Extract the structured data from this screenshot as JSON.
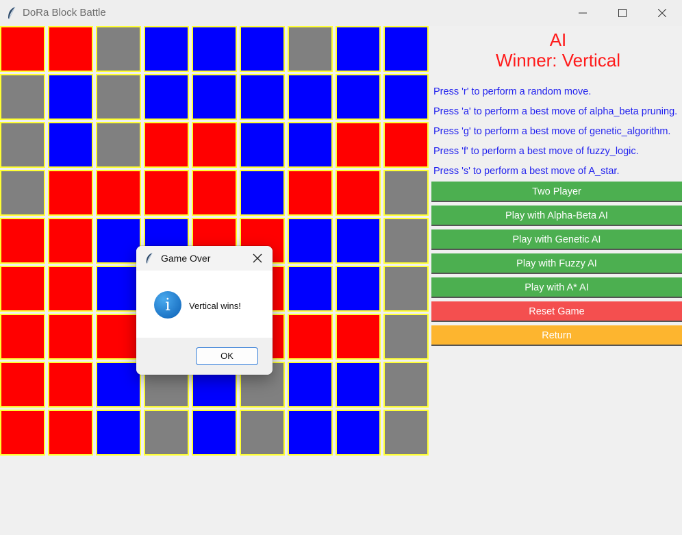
{
  "window": {
    "title": "DoRa Block Battle",
    "min_icon": "minimize-icon",
    "max_icon": "maximize-icon",
    "close_icon": "close-icon"
  },
  "colors": {
    "R": "#ff0000",
    "B": "#0000ff",
    "G": "#808080",
    "cell_border": "#ffff33",
    "title_red": "#ff1a1a",
    "hint_blue": "#2222ee",
    "btn_green": "#4caf50",
    "btn_red": "#f44f4f",
    "btn_orange": "#fdb52f"
  },
  "board": {
    "rows": [
      [
        "R",
        "R",
        "G",
        "B",
        "B",
        "B",
        "G",
        "B",
        "B"
      ],
      [
        "G",
        "B",
        "G",
        "B",
        "B",
        "B",
        "B",
        "B",
        "B"
      ],
      [
        "G",
        "B",
        "G",
        "R",
        "R",
        "B",
        "B",
        "R",
        "R"
      ],
      [
        "G",
        "R",
        "R",
        "R",
        "R",
        "B",
        "R",
        "R",
        "G"
      ],
      [
        "R",
        "R",
        "B",
        "B",
        "R",
        "R",
        "B",
        "B",
        "G"
      ],
      [
        "R",
        "R",
        "B",
        "B",
        "R",
        "R",
        "B",
        "B",
        "G"
      ],
      [
        "R",
        "R",
        "R",
        "R",
        "R",
        "R",
        "R",
        "R",
        "G"
      ],
      [
        "R",
        "R",
        "B",
        "G",
        "B",
        "G",
        "B",
        "B",
        "G"
      ],
      [
        "R",
        "R",
        "B",
        "G",
        "B",
        "G",
        "B",
        "B",
        "G"
      ]
    ]
  },
  "panel": {
    "mode": "AI",
    "winner": "Winner: Vertical",
    "hints": [
      "Press 'r' to perform a random move.",
      "Press 'a' to perform a best move of alpha_beta pruning.",
      "Press 'g' to perform a best move of genetic_algorithm.",
      "Press 'f' to perform a best move of fuzzy_logic.",
      "Press 's' to perform a best move of A_star."
    ],
    "buttons": [
      {
        "label": "Two Player",
        "color": "#4caf50"
      },
      {
        "label": "Play with Alpha-Beta AI",
        "color": "#4caf50"
      },
      {
        "label": "Play with Genetic AI",
        "color": "#4caf50"
      },
      {
        "label": "Play with Fuzzy AI",
        "color": "#4caf50"
      },
      {
        "label": "Play with A* AI",
        "color": "#4caf50"
      },
      {
        "label": "Reset Game",
        "color": "#f44f4f"
      },
      {
        "label": "Return",
        "color": "#fdb52f"
      }
    ]
  },
  "dialog": {
    "title": "Game Over",
    "message": "Vertical wins!",
    "ok_label": "OK",
    "icon": "info-icon"
  }
}
